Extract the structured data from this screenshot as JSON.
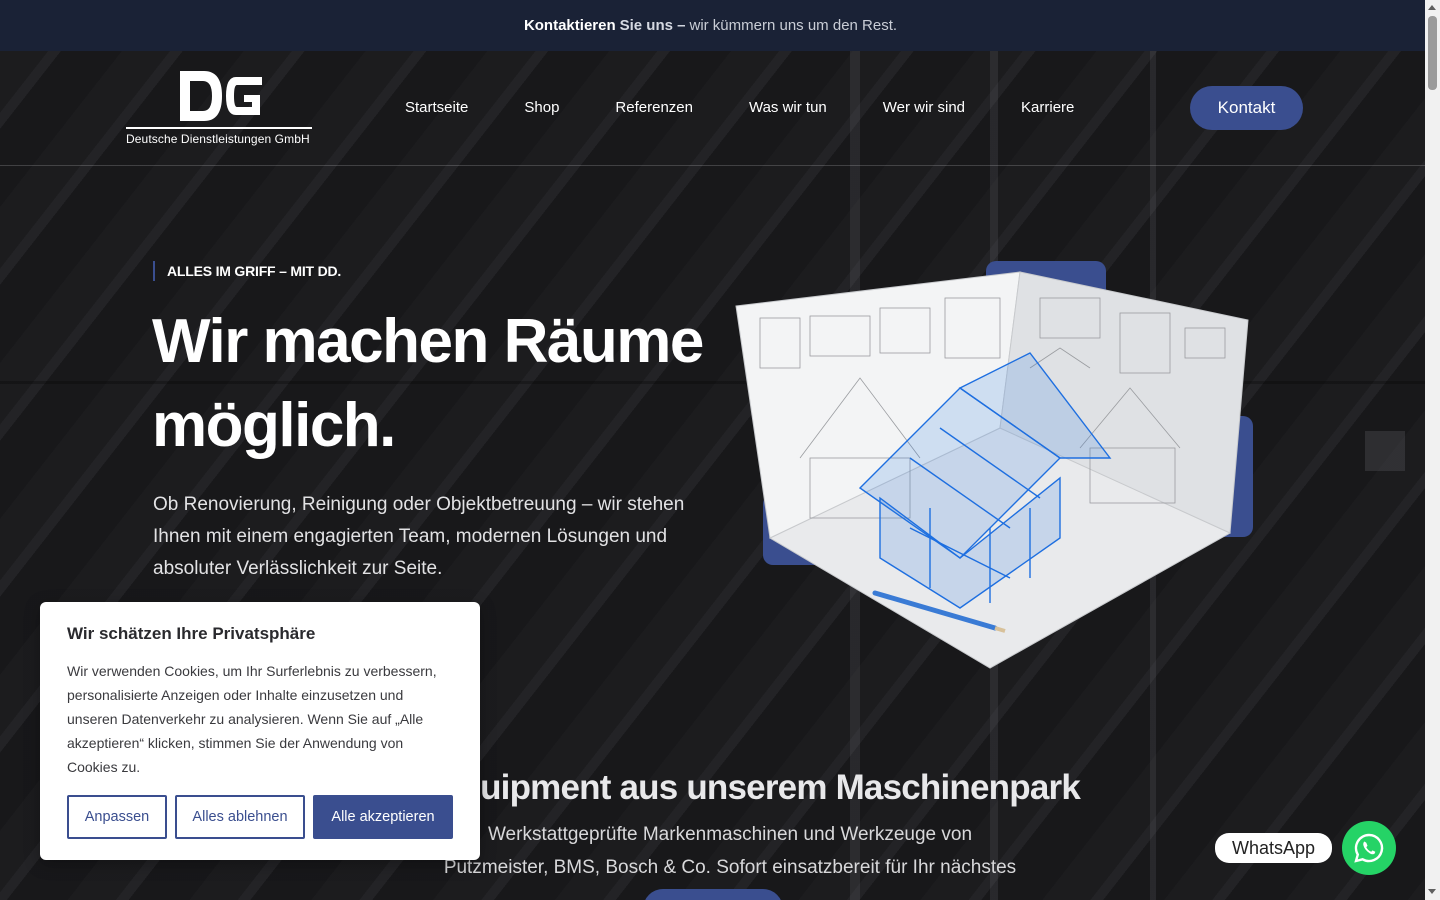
{
  "topbar": {
    "part1": "Kontaktieren",
    "part2": "Sie uns –",
    "part3": "wir kümmern uns um den Rest."
  },
  "logo": {
    "monogram": "DG",
    "company": "Deutsche Dienstleistungen GmbH"
  },
  "nav": {
    "items": [
      "Startseite",
      "Shop",
      "Referenzen",
      "Was wir tun",
      "Wer wir sind",
      "Karriere"
    ],
    "cta": "Kontakt"
  },
  "hero": {
    "eyebrow": "ALLES IM GRIFF – MIT DD.",
    "title_line1": "Wir machen Räume",
    "title_line2": "möglich.",
    "description": "Ob Renovierung, Reinigung oder Objektbetreuung – wir stehen Ihnen mit einem engagierten Team, modernen Lösungen und absoluter Verlässlichkeit zur Seite.",
    "image": "3d-house-blueprint-illustration"
  },
  "section2": {
    "title": "Equipment aus unserem Maschinenpark",
    "description": "Werkstattgeprüfte Markenmaschinen und Werkzeuge von Putzmeister, BMS, Bosch & Co. Sofort einsatzbereit für Ihr nächstes Projekt."
  },
  "cookie": {
    "title": "Wir schätzen Ihre Privatsphäre",
    "text": "Wir verwenden Cookies, um Ihr Surferlebnis zu verbessern, personalisierte Anzeigen oder Inhalte einzusetzen und unseren Datenverkehr zu analysieren. Wenn Sie auf „Alle akzeptieren“ klicken, stimmen Sie der Anwendung von Cookies zu.",
    "btn_customize": "Anpassen",
    "btn_reject": "Alles ablehnen",
    "btn_accept": "Alle akzeptieren"
  },
  "whatsapp": {
    "label": "WhatsApp",
    "icon": "whatsapp-icon"
  },
  "colors": {
    "accent": "#3a4e8f",
    "topbar": "#1a2236",
    "whatsapp": "#25d366"
  }
}
